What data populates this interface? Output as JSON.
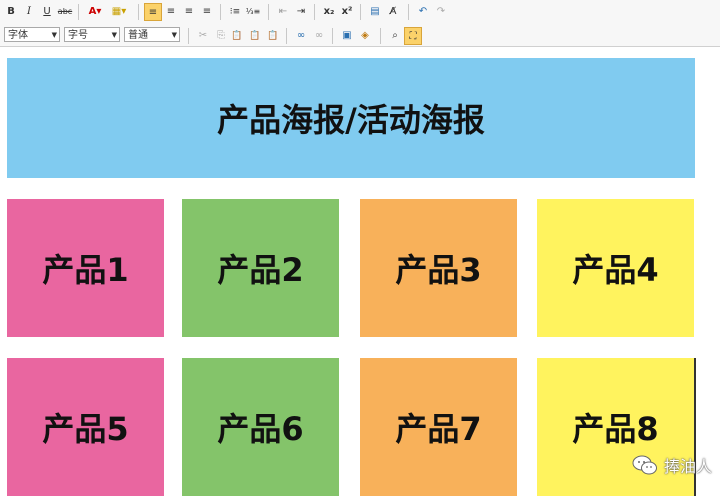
{
  "toolbar": {
    "row1": [
      {
        "name": "bold-button",
        "glyph": "B"
      },
      {
        "name": "italic-button",
        "glyph": "I"
      },
      {
        "name": "underline-button",
        "glyph": "U"
      },
      {
        "name": "strikethrough-button",
        "glyph": "abc"
      },
      {
        "name": "font-color-button",
        "glyph": "A▾"
      },
      {
        "name": "highlight-color-button",
        "glyph": "▦▾"
      },
      {
        "name": "align-left-button",
        "glyph": "≡"
      },
      {
        "name": "align-center-button",
        "glyph": "≡"
      },
      {
        "name": "align-right-button",
        "glyph": "≡"
      },
      {
        "name": "align-justify-button",
        "glyph": "≡"
      },
      {
        "name": "bulleted-list-button",
        "glyph": "⁝≡"
      },
      {
        "name": "numbered-list-button",
        "glyph": "⅓≡"
      },
      {
        "name": "outdent-button",
        "glyph": "⇤"
      },
      {
        "name": "indent-button",
        "glyph": "⇥"
      },
      {
        "name": "subscript-button",
        "glyph": "x₂"
      },
      {
        "name": "superscript-button",
        "glyph": "x²"
      },
      {
        "name": "format-button",
        "glyph": "▤"
      },
      {
        "name": "clear-format-button",
        "glyph": "A̸"
      },
      {
        "name": "undo-button",
        "glyph": "↶"
      },
      {
        "name": "redo-button",
        "glyph": "↷"
      }
    ],
    "font_family": "字体",
    "font_size": "字号",
    "paragraph_style": "普通",
    "row2": [
      {
        "name": "cut-button",
        "glyph": "✂"
      },
      {
        "name": "copy-button",
        "glyph": "⎘"
      },
      {
        "name": "paste-button",
        "glyph": "📋"
      },
      {
        "name": "paste-text-button",
        "glyph": "📋"
      },
      {
        "name": "paste-word-button",
        "glyph": "📋"
      },
      {
        "name": "link-button",
        "glyph": "∞"
      },
      {
        "name": "unlink-button",
        "glyph": "∞"
      },
      {
        "name": "image-button",
        "glyph": "▣"
      },
      {
        "name": "media-button",
        "glyph": "◈"
      },
      {
        "name": "find-button",
        "glyph": "⌕"
      },
      {
        "name": "maximize-button",
        "glyph": "⛶"
      }
    ]
  },
  "banner": {
    "text": "产品海报/活动海报"
  },
  "tiles": [
    "产品1",
    "产品2",
    "产品3",
    "产品4",
    "产品5",
    "产品6",
    "产品7",
    "产品8"
  ],
  "watermark": {
    "text": "捧油人"
  },
  "colors": {
    "banner": "#80cbf0",
    "pink": "#e966a0",
    "green": "#84c46a",
    "orange": "#f8b15a",
    "yellow": "#fff35e"
  }
}
